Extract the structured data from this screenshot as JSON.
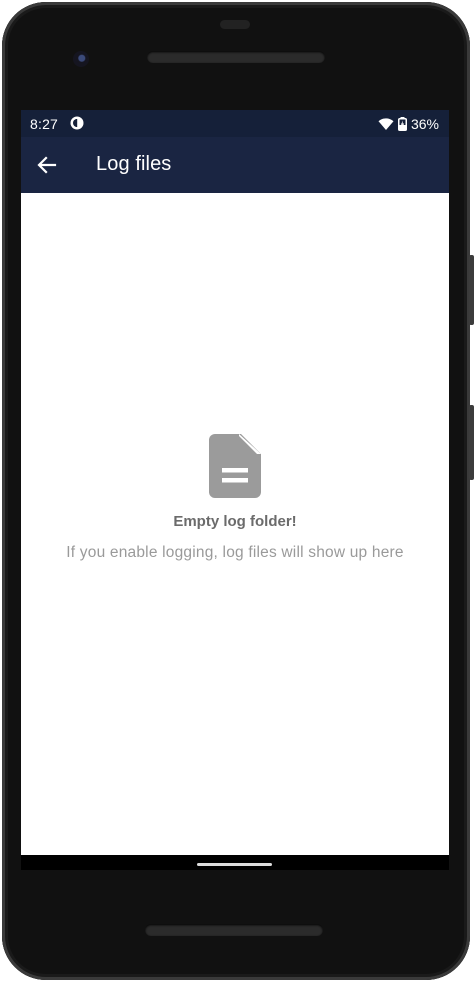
{
  "status_bar": {
    "time": "8:27",
    "app_icon": "circle-half-icon",
    "wifi_icon": "wifi-icon",
    "battery_icon": "battery-charging-icon",
    "battery_percent": "36%"
  },
  "toolbar": {
    "back_icon": "arrow-back-icon",
    "title": "Log files",
    "background_color": "#1a2542"
  },
  "empty_state": {
    "icon": "document-icon",
    "title": "Empty log folder!",
    "subtitle": "If you enable logging, log files will show up here"
  }
}
